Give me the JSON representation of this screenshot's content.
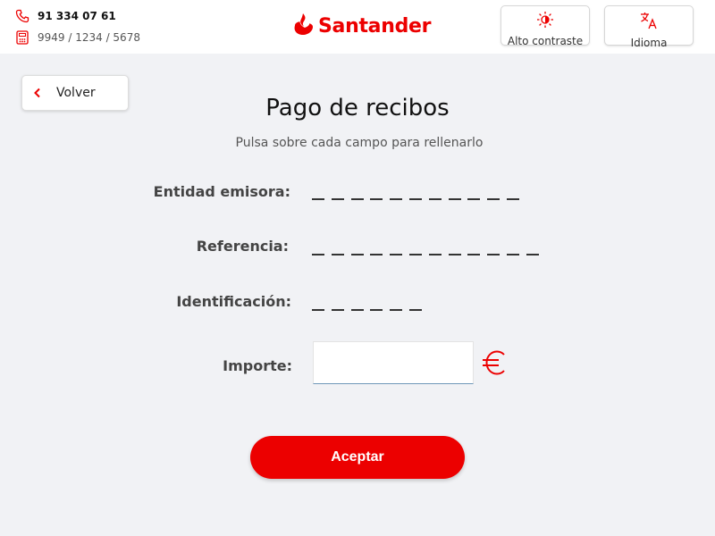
{
  "header": {
    "phone": "91 334 07 61",
    "atm_id": "9949 / 1234 / 5678",
    "brand": "Santander",
    "contrast_label": "Alto contraste",
    "language_label": "Idioma"
  },
  "nav": {
    "back_label": "Volver"
  },
  "page": {
    "title": "Pago de recibos",
    "subtitle": "Pulsa sobre cada campo para rellenarlo"
  },
  "form": {
    "fields": [
      {
        "label": "Entidad emisora:",
        "digits": 11,
        "value": ""
      },
      {
        "label": "Referencia:",
        "digits": 12,
        "value": ""
      },
      {
        "label": "Identificación:",
        "digits": 6,
        "value": ""
      },
      {
        "label": "Importe:",
        "value": "",
        "currency_icon": "euro-icon"
      }
    ],
    "submit_label": "Aceptar"
  },
  "colors": {
    "brand_red": "#ec0000",
    "background": "#f1f2f5"
  },
  "icons": [
    "phone-icon",
    "atm-icon",
    "santander-flame-icon",
    "sun-contrast-icon",
    "translate-icon",
    "chevron-left-icon",
    "euro-icon"
  ]
}
